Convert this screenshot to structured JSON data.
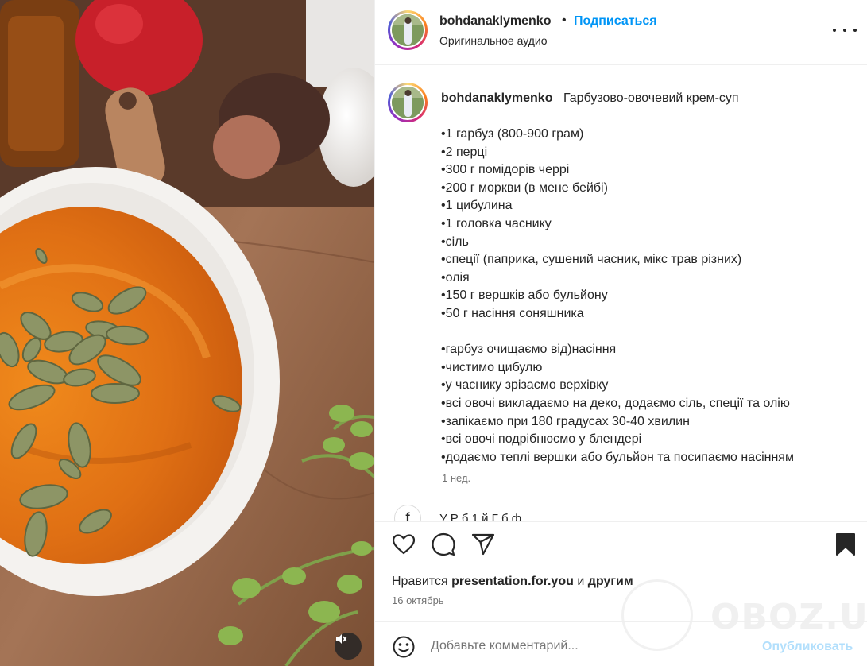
{
  "post": {
    "username": "bohdanaklymenko",
    "separator": "•",
    "follow_label": "Подписаться",
    "audio_label": "Оригинальное аудио",
    "more_icon": "more-horizontal-icon"
  },
  "caption": {
    "username": "bohdanaklymenko",
    "title": "Гарбузово-овочевий крем-суп",
    "lines": [
      "•1 гарбуз (800-900 грам)",
      "•2 перці",
      "•300 г помідорів черрі",
      "•200 г моркви (в мене бейбі)",
      "•1 цибулина",
      "•1 головка часнику",
      "•сіль",
      "•спеції (паприка, сушений часник, мікс трав різних)",
      "•олія",
      "•150 г вершків або бульйону",
      "•50 г насіння соняшника",
      "",
      "•гарбуз очищаємо від)насіння",
      "•чистимо цибулю",
      "•у часнику зрізаємо верхівку",
      "•всі овочі викладаємо на деко, додаємо сіль, спеції та олію",
      "•запікаємо при 180 градусах 30-40 хвилин",
      "•всі овочі подрібнюємо у блендері",
      "•додаємо теплі вершки або бульйон та посипаємо насінням"
    ],
    "time_ago": "1 нед.",
    "next_comment_avatar": "f",
    "next_comment_peek": "У         Р    б 1                      й      Г     б      ф"
  },
  "actions": {
    "icons": [
      "heart-icon",
      "comment-icon",
      "share-icon",
      "bookmark-icon"
    ],
    "likes_prefix": "Нравится",
    "likes_user": "presentation.for.you",
    "likes_and": "и",
    "likes_others": "другим",
    "date": "16 октябрь"
  },
  "watermark": {
    "text": "OBOZ.UA"
  },
  "comment": {
    "placeholder": "Добавьте комментарий...",
    "publish_label": "Опубликовать",
    "emoji_icon": "emoji-icon"
  },
  "media": {
    "mute_icon": "volume-off-icon"
  },
  "colors": {
    "accent": "#0095f6",
    "publish_disabled": "#b2dffc",
    "muted_text": "#737373",
    "soup": "#e67e1a"
  }
}
